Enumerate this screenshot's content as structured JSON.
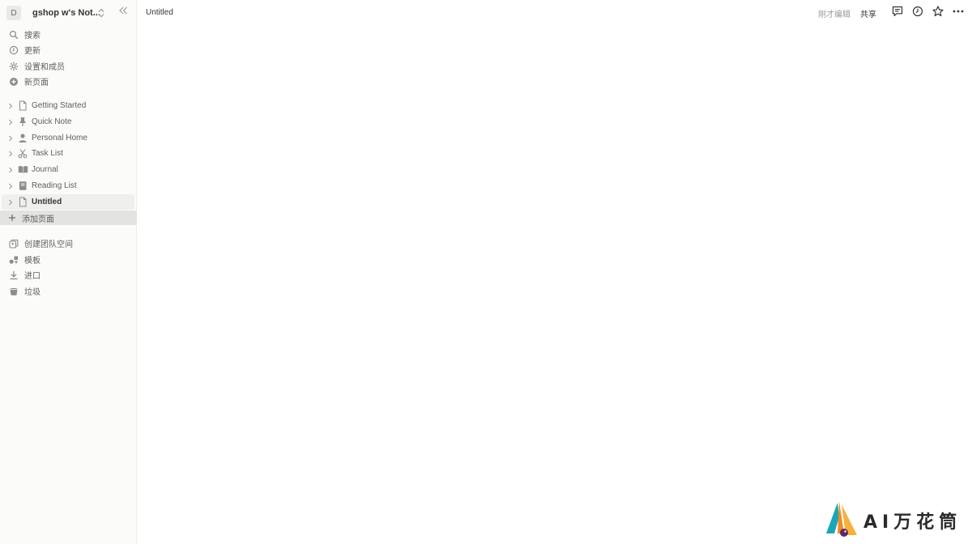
{
  "workspace": {
    "avatar_letter": "D",
    "name": "gshop w's Not..."
  },
  "sidebar": {
    "nav": [
      {
        "label": "搜索",
        "icon": "search-icon"
      },
      {
        "label": "更新",
        "icon": "clock-icon"
      },
      {
        "label": "设置和成员",
        "icon": "gear-icon"
      },
      {
        "label": "新页面",
        "icon": "plus-circle-icon"
      }
    ],
    "pages": [
      {
        "label": "Getting Started",
        "icon": "page-icon"
      },
      {
        "label": "Quick Note",
        "icon": "pin-icon"
      },
      {
        "label": "Personal Home",
        "icon": "person-icon"
      },
      {
        "label": "Task List",
        "icon": "scissors-icon"
      },
      {
        "label": "Journal",
        "icon": "book-icon"
      },
      {
        "label": "Reading List",
        "icon": "notebook-icon"
      },
      {
        "label": "Untitled",
        "icon": "page-icon",
        "active": true
      }
    ],
    "add_page_label": "添加页面",
    "bottom": [
      {
        "label": "创建团队空间",
        "icon": "teamspace-icon"
      },
      {
        "label": "模板",
        "icon": "shapes-icon"
      },
      {
        "label": "进口",
        "icon": "download-icon"
      },
      {
        "label": "垃圾",
        "icon": "trash-icon"
      }
    ]
  },
  "topbar": {
    "breadcrumb": "Untitled",
    "edited_status": "刚才编辑",
    "share_label": "共享",
    "icons": [
      "comment-icon",
      "history-icon",
      "star-icon",
      "more-icon"
    ]
  },
  "watermark": {
    "text": "AI万花筒"
  },
  "colors": {
    "sidebar_bg": "#fbfbfa",
    "active_row": "#efefed",
    "hover_row": "#e3e3e1",
    "text": "#37352f",
    "muted": "#5f5e5b"
  }
}
